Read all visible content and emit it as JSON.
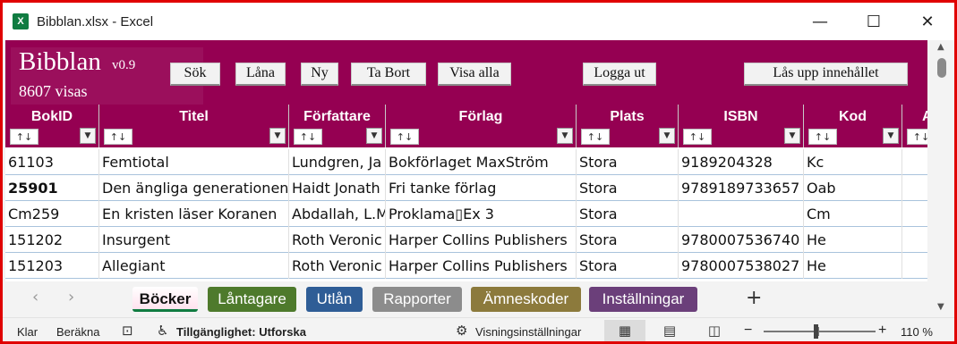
{
  "window": {
    "title": "Bibblan.xlsx - Excel",
    "app_icon_letter": "X",
    "minimize": "—",
    "maximize": "☐",
    "close": "✕"
  },
  "banner": {
    "app_name": "Bibblan",
    "version": "v0.9",
    "count_text": "8607 visas",
    "color": "#950052",
    "buttons": {
      "search": "Sök",
      "borrow": "Låna",
      "new": "Ny",
      "delete": "Ta Bort",
      "show_all": "Visa alla",
      "logout": "Logga ut",
      "unlock": "Lås upp innehållet"
    }
  },
  "table": {
    "sort_symbol": "↑↓",
    "filter_symbol": "▼",
    "headers": [
      "BokID",
      "Titel",
      "Författare",
      "Förlag",
      "Plats",
      "ISBN",
      "Kod",
      "A"
    ],
    "rows": [
      [
        "61103",
        "Femtiotal",
        "Lundgren, Ja",
        "Bokförlaget MaxStröm",
        "Stora",
        "9189204328",
        "Kc"
      ],
      [
        "25901",
        "Den ängliga generationen",
        "Haidt Jonath",
        "Fri tanke förlag",
        "Stora",
        "9789189733657",
        "Oab"
      ],
      [
        "Cm259",
        "En kristen läser Koranen",
        "Abdallah, L.M",
        "Proklama▯Ex 3",
        "Stora",
        "",
        "Cm"
      ],
      [
        "151202",
        "Insurgent",
        "Roth Veronic",
        "Harper Collins Publishers",
        "Stora",
        "9780007536740",
        "He"
      ],
      [
        "151203",
        "Allegiant",
        "Roth Veronic",
        "Harper Collins Publishers",
        "Stora",
        "9780007538027",
        "He"
      ]
    ]
  },
  "scrollbar": {
    "up": "▲",
    "down": "▼"
  },
  "sheet_tabs": {
    "prev": "‹",
    "next": "›",
    "add": "+",
    "tabs": [
      {
        "label": "Böcker",
        "color": "#ffffff",
        "active": true
      },
      {
        "label": "Låntagare",
        "color": "#4e7a2c"
      },
      {
        "label": "Utlån",
        "color": "#2f5d96"
      },
      {
        "label": "Rapporter",
        "color": "#8c8c8c"
      },
      {
        "label": "Ämneskoder",
        "color": "#8c7a3c"
      },
      {
        "label": "Inställningar",
        "color": "#6b3f7a"
      }
    ]
  },
  "statusbar": {
    "ready": "Klar",
    "calculate": "Beräkna",
    "accessibility": "Tillgänglighet: Utforska",
    "view_settings": "Visningsinställningar",
    "zoom_minus": "−",
    "zoom_plus": "+",
    "zoom_level": "110 %"
  }
}
